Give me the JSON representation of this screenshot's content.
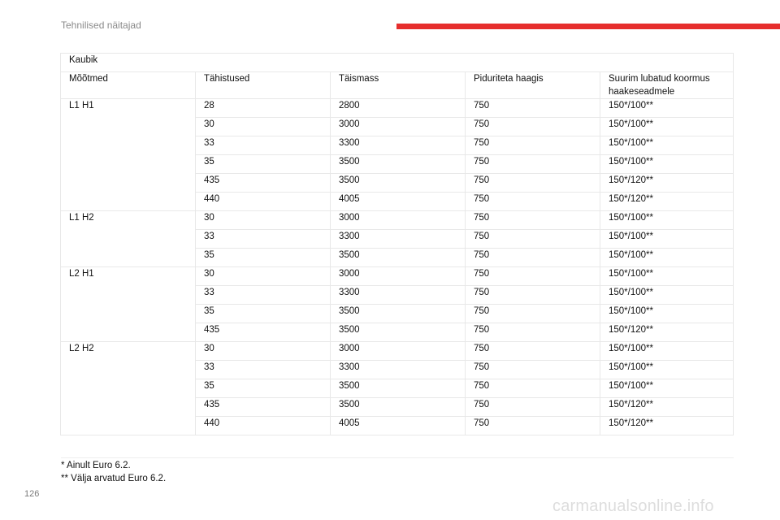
{
  "header": {
    "title": "Tehnilised näitajad"
  },
  "table": {
    "caption": "Kaubik",
    "columns": [
      "Mõõtmed",
      "Tähistused",
      "Täismass",
      "Piduriteta haagis",
      "Suurim lubatud koormus haakeseadmele"
    ],
    "groups": [
      {
        "dimension": "L1 H1",
        "rows": [
          [
            "28",
            "2800",
            "750",
            "150*/100**"
          ],
          [
            "30",
            "3000",
            "750",
            "150*/100**"
          ],
          [
            "33",
            "3300",
            "750",
            "150*/100**"
          ],
          [
            "35",
            "3500",
            "750",
            "150*/100**"
          ],
          [
            "435",
            "3500",
            "750",
            "150*/120**"
          ],
          [
            "440",
            "4005",
            "750",
            "150*/120**"
          ]
        ]
      },
      {
        "dimension": "L1 H2",
        "rows": [
          [
            "30",
            "3000",
            "750",
            "150*/100**"
          ],
          [
            "33",
            "3300",
            "750",
            "150*/100**"
          ],
          [
            "35",
            "3500",
            "750",
            "150*/100**"
          ]
        ]
      },
      {
        "dimension": "L2 H1",
        "rows": [
          [
            "30",
            "3000",
            "750",
            "150*/100**"
          ],
          [
            "33",
            "3300",
            "750",
            "150*/100**"
          ],
          [
            "35",
            "3500",
            "750",
            "150*/100**"
          ],
          [
            "435",
            "3500",
            "750",
            "150*/120**"
          ]
        ]
      },
      {
        "dimension": "L2 H2",
        "rows": [
          [
            "30",
            "3000",
            "750",
            "150*/100**"
          ],
          [
            "33",
            "3300",
            "750",
            "150*/100**"
          ],
          [
            "35",
            "3500",
            "750",
            "150*/100**"
          ],
          [
            "435",
            "3500",
            "750",
            "150*/120**"
          ],
          [
            "440",
            "4005",
            "750",
            "150*/120**"
          ]
        ]
      }
    ]
  },
  "footnotes": [
    "* Ainult Euro 6.2.",
    "** Välja arvatud Euro 6.2."
  ],
  "page_number": "126",
  "watermark": "carmanualsonline.info",
  "colors": {
    "accent": "#e62e2d",
    "border": "#e8e8e8",
    "muted": "#8a8a8a"
  }
}
